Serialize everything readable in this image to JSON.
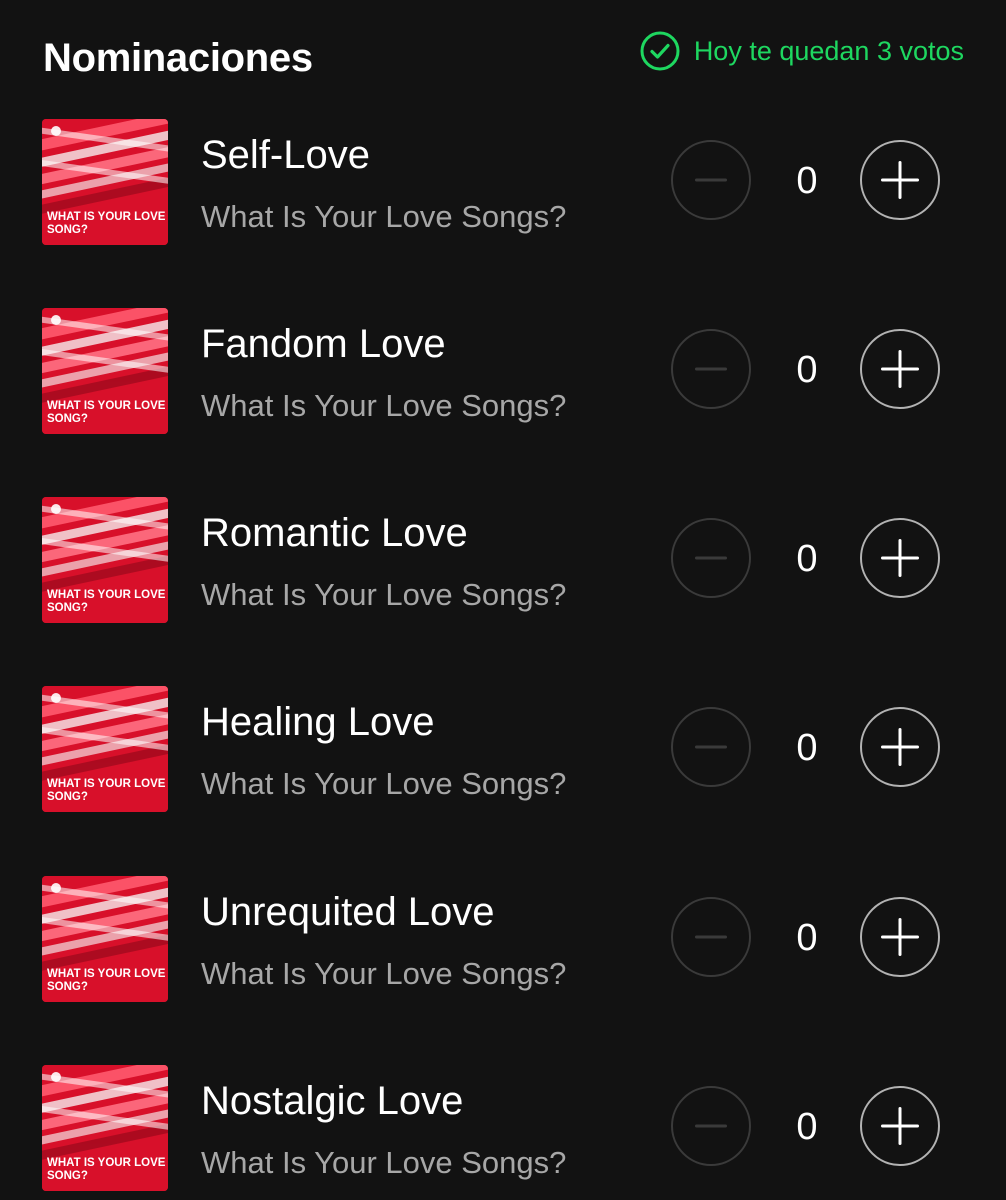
{
  "header": {
    "title": "Nominaciones",
    "votes_remaining_text": "Hoy te quedan 3 votos",
    "votes_icon": "check-circle-icon",
    "accent_color": "#1ed760"
  },
  "cover_art": {
    "caption_line1": "WHAT IS YOUR LOVE",
    "caption_line2": "SONG?",
    "ribbon_text": "WHAT IS YOUR LOVE SONG?",
    "background_color": "#d8102a"
  },
  "nominations": [
    {
      "title": "Self-Love",
      "subtitle": "What Is Your Love Songs?",
      "count": "0"
    },
    {
      "title": "Fandom Love",
      "subtitle": "What Is Your Love Songs?",
      "count": "0"
    },
    {
      "title": "Romantic Love",
      "subtitle": "What Is Your Love Songs?",
      "count": "0"
    },
    {
      "title": "Healing Love",
      "subtitle": "What Is Your Love Songs?",
      "count": "0"
    },
    {
      "title": "Unrequited Love",
      "subtitle": "What Is Your Love Songs?",
      "count": "0"
    },
    {
      "title": "Nostalgic Love",
      "subtitle": "What Is Your Love Songs?",
      "count": "0"
    }
  ],
  "controls": {
    "decrement_icon": "minus-icon",
    "increment_icon": "plus-icon"
  }
}
